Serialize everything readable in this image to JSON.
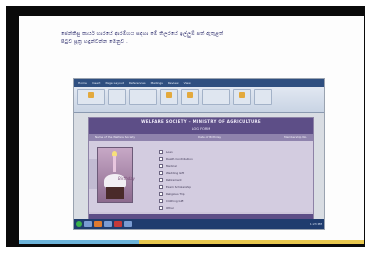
{
  "caption": {
    "line1": "ජෙන්කිසු කාර්ය භාරයේ ආරම්භය සඳහා මේ තිලරයේ ඉල්ලුම් පත් ඇතුළත්",
    "line2": "පිටුව සූත්‍ර හඳුන්වන්න මෙනුව ."
  },
  "ribbon": {
    "menu": [
      "Home",
      "Insert",
      "Page Layout",
      "References",
      "Mailings",
      "Review",
      "View"
    ]
  },
  "form": {
    "title": "WELFARE SOCIETY – MINISTRY OF AGRICULTURE",
    "subtitle": "LOG FORM",
    "info_left": "Name of the Welfare Society",
    "info_mid": "Date of Birthday",
    "info_right": "Membership No.",
    "photo_label": "Birthday",
    "options": [
      "Loan",
      "Death Contribution",
      "Medical",
      "Wedding Gift",
      "Retirement",
      "Exam Scholarship",
      "Religious Trip",
      "Clothing Gift",
      "Other"
    ]
  },
  "taskbar": {
    "tray_text": "1:23 PM"
  },
  "colors": {
    "accent_blue": "#6cb3d9",
    "accent_gold": "#e8c84f",
    "form_header": "#5d4e87"
  }
}
